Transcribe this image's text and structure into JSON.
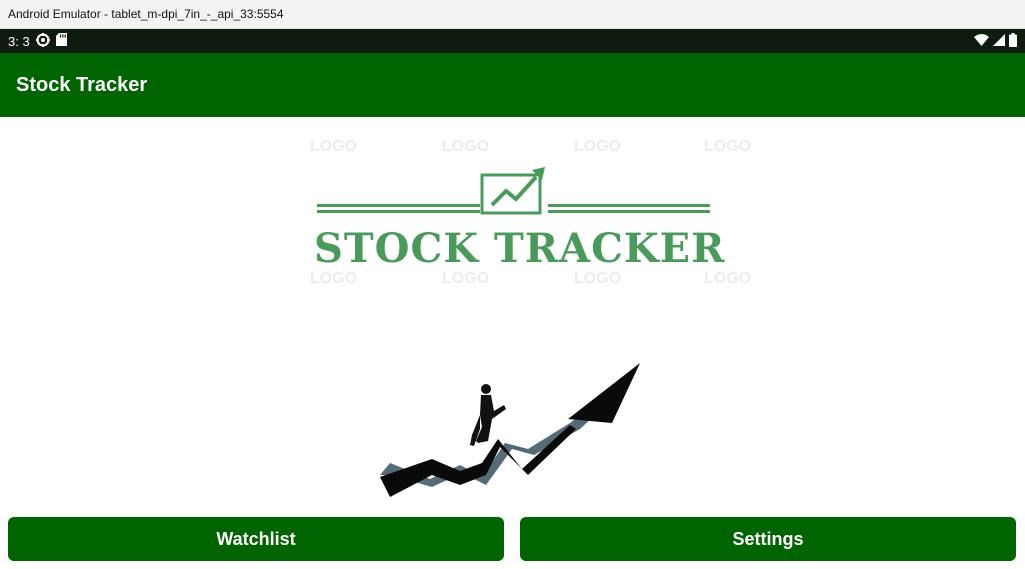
{
  "window": {
    "title": "Android Emulator - tablet_m-dpi_7in_-_api_33:5554"
  },
  "status_bar": {
    "time": "3: 3",
    "left_icons": [
      "settings-gear-icon",
      "sd-card-icon"
    ],
    "right_icons": [
      "wifi-icon",
      "cell-signal-icon",
      "battery-icon"
    ]
  },
  "app_bar": {
    "title": "Stock Tracker"
  },
  "logo": {
    "text": "STOCK TRACKER",
    "brand_color": "#4a9a5c",
    "watermark_text": "LOGO"
  },
  "buttons": {
    "watchlist_label": "Watchlist",
    "settings_label": "Settings",
    "color": "#006400"
  },
  "colors": {
    "app_bar": "#006400",
    "status_bar": "#0e1b0e"
  }
}
